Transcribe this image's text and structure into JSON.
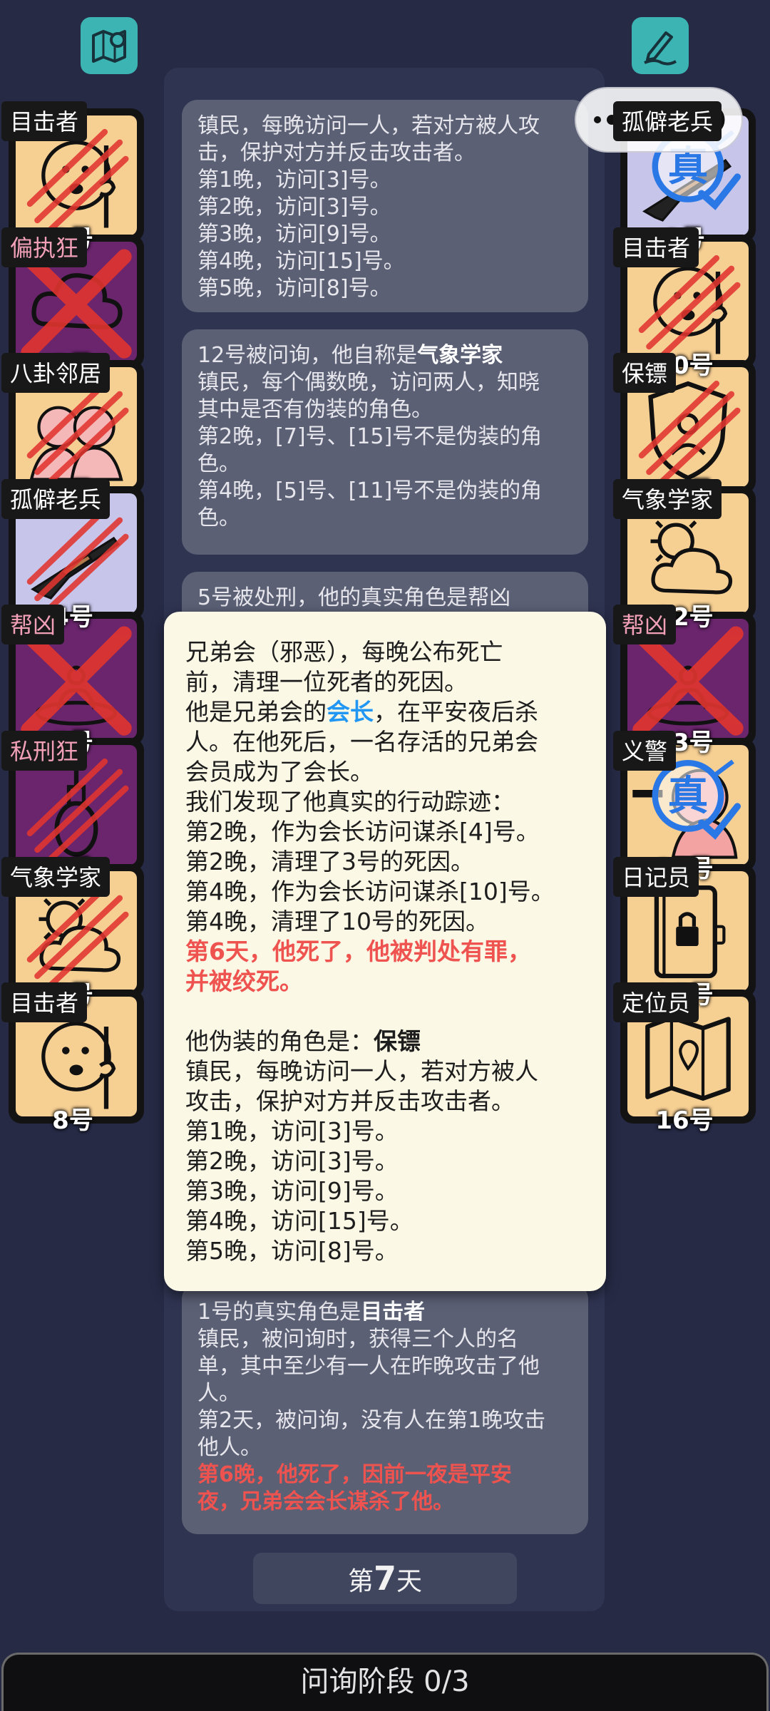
{
  "top": {
    "map_icon": "map-pin-icon",
    "note_icon": "edit-icon"
  },
  "capsule": {
    "menu_icon": "more-dots-icon",
    "close_icon": "target-circle-icon"
  },
  "players_left": [
    {
      "role": "目击者",
      "number": "1号",
      "icon": "witness-face-icon",
      "color": "peach",
      "dead": "claw",
      "evil": false
    },
    {
      "role": "偏执狂",
      "number": "2号",
      "icon": "cloud-icon",
      "color": "purple",
      "dead": "x",
      "evil": true
    },
    {
      "role": "八卦邻居",
      "number": "3号",
      "icon": "gossip-people-icon",
      "color": "peach",
      "dead": "claw",
      "evil": false
    },
    {
      "role": "孤僻老兵",
      "number": "4号",
      "icon": "rifle-icon",
      "color": "lav",
      "dead": "claw",
      "evil": false
    },
    {
      "role": "帮凶",
      "number": "5号",
      "icon": "puddle-icon",
      "color": "purple",
      "dead": "x",
      "evil": true
    },
    {
      "role": "私刑狂",
      "number": "6号",
      "icon": "noose-icon",
      "color": "purple",
      "dead": "claw",
      "evil": true
    },
    {
      "role": "气象学家",
      "number": "7号",
      "icon": "sun-cloud-icon",
      "color": "peach",
      "dead": "claw",
      "evil": false
    },
    {
      "role": "目击者",
      "number": "8号",
      "icon": "witness-face-icon",
      "color": "peach",
      "dead": "",
      "evil": false
    }
  ],
  "players_right": [
    {
      "role": "孤僻老兵",
      "number": "9号",
      "icon": "rifle-icon",
      "color": "lav",
      "dead": "",
      "evil": false,
      "stamp": "真"
    },
    {
      "role": "目击者",
      "number": "10号",
      "icon": "witness-face-icon",
      "color": "peach",
      "dead": "claw",
      "evil": false
    },
    {
      "role": "保镖",
      "number": "11号",
      "icon": "shield-icon",
      "color": "peach",
      "dead": "claw",
      "evil": false
    },
    {
      "role": "气象学家",
      "number": "12号",
      "icon": "sun-cloud-icon",
      "color": "peach",
      "dead": "",
      "evil": false
    },
    {
      "role": "帮凶",
      "number": "13号",
      "icon": "puddle-icon",
      "color": "purple",
      "dead": "x",
      "evil": true
    },
    {
      "role": "义警",
      "number": "14号",
      "icon": "vigilante-icon",
      "color": "peach",
      "dead": "",
      "evil": false,
      "stamp": "真"
    },
    {
      "role": "日记员",
      "number": "15号",
      "icon": "locked-diary-icon",
      "color": "peach",
      "dead": "",
      "evil": false
    },
    {
      "role": "定位员",
      "number": "16号",
      "icon": "map-icon",
      "color": "peach",
      "dead": "",
      "evil": false
    }
  ],
  "log": {
    "card1": [
      "镇民，每晚访问一人，若对方被人攻",
      "击，保护对方并反击攻击者。",
      "第1晚，访问[3]号。",
      "第2晚，访问[3]号。",
      "第3晚，访问[9]号。",
      "第4晚，访问[15]号。",
      "第5晚，访问[8]号。"
    ],
    "card2_prefix": "12号被问询，他自称是",
    "card2_role": "气象学家",
    "card2_lines": [
      "镇民，每个偶数晚，访问两人，知晓",
      "其中是否有伪装的角色。",
      "第2晚，[7]号、[15]号不是伪装的角",
      "色。",
      "第4晚，[5]号、[11]号不是伪装的角",
      "色。"
    ],
    "card3_prefix": "5号被处刑，他的真实角色是帮凶",
    "card4_prefix": "1号的真实角色是",
    "card4_role": "目击者",
    "card4_lines": [
      "镇民，被问询时，获得三个人的名",
      "单，其中至少有一人在昨晚攻击了他",
      "人。",
      "第2天，被问询，没有人在第1晚攻击",
      "他人。"
    ],
    "card4_red": [
      "第6晚，他死了，因前一夜是平安",
      "夜，兄弟会会长谋杀了他。"
    ]
  },
  "day": {
    "prefix": "第",
    "num": "7",
    "suffix": "天"
  },
  "popup": {
    "l1": "兄弟会（邪恶），每晚公布死亡",
    "l2": "前，清理一位死者的死因。",
    "l3_a": "他是兄弟会的",
    "l3_b": "会长",
    "l3_c": "，在平安夜后杀",
    "l4": "人。在他死后，一名存活的兄弟会",
    "l5": "会员成为了会长。",
    "l6": "我们发现了他真实的行动踪迹：",
    "l7": "第2晚，作为会长访问谋杀[4]号。",
    "l8": "第2晚，清理了3号的死因。",
    "l9": "第4晚，作为会长访问谋杀[10]号。",
    "l10": "第4晚，清理了10号的死因。",
    "red1": "第6天，他死了，他被判处有罪，",
    "red2": "并被绞死。",
    "disguise_a": "他伪装的角色是：",
    "disguise_b": "保镖",
    "d1": "镇民，每晚访问一人，若对方被人",
    "d2": "攻击，保护对方并反击攻击者。",
    "d3": "第1晚，访问[3]号。",
    "d4": "第2晚，访问[3]号。",
    "d5": "第3晚，访问[9]号。",
    "d6": "第4晚，访问[15]号。",
    "d7": "第5晚，访问[8]号。"
  },
  "bottom": {
    "phase": "问询阶段 0/3"
  }
}
